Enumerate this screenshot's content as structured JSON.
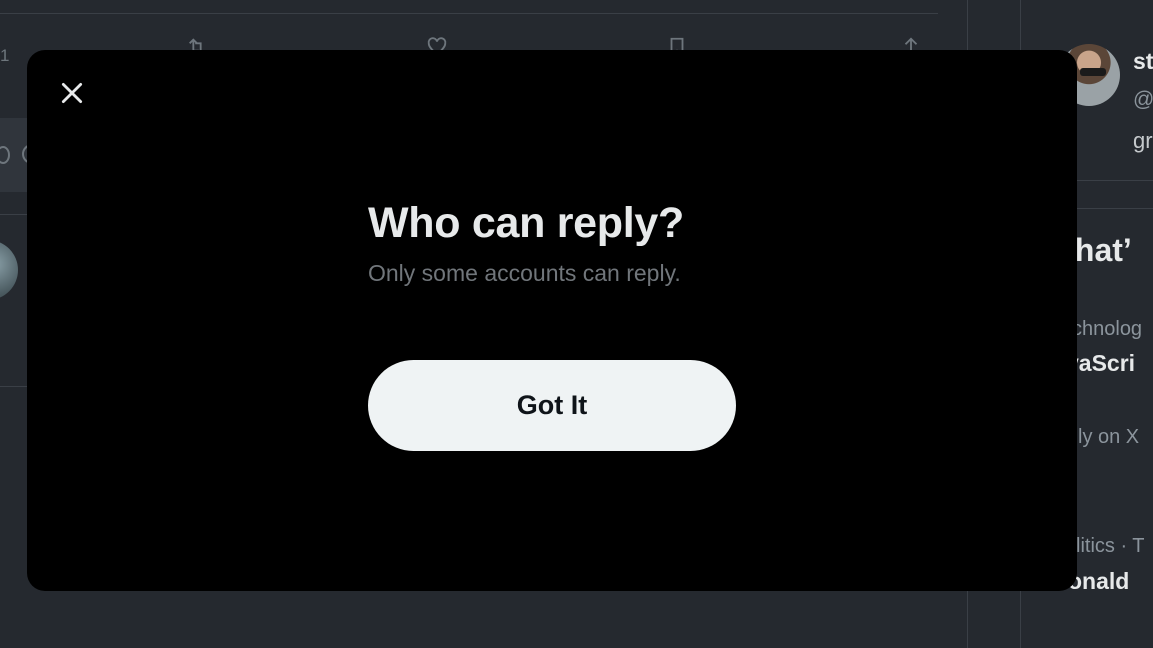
{
  "background": {
    "timeline": {
      "reply_count": "1"
    },
    "sidebar": {
      "user_name_fragment": "st",
      "user_handle_fragment": "@",
      "user_bio_fragment": "gr",
      "section_title_fragment": "/hat’",
      "trends": [
        {
          "category_fragment": "chnolog",
          "title_fragment": "vaScri"
        },
        {
          "category_fragment": "ly on X",
          "title_fragment": ""
        },
        {
          "category_fragment": "litics · T",
          "title_fragment": "onald"
        }
      ]
    }
  },
  "modal": {
    "title": "Who can reply?",
    "subtitle": "Only some accounts can reply.",
    "button_label": "Got It",
    "close_icon": "close-icon"
  },
  "colors": {
    "modal_bg": "#000000",
    "page_bg": "#25292f",
    "button_bg": "#eff3f4",
    "button_text": "#0f1419",
    "title_text": "#e7e9ea",
    "subtitle_text": "#71767b"
  }
}
